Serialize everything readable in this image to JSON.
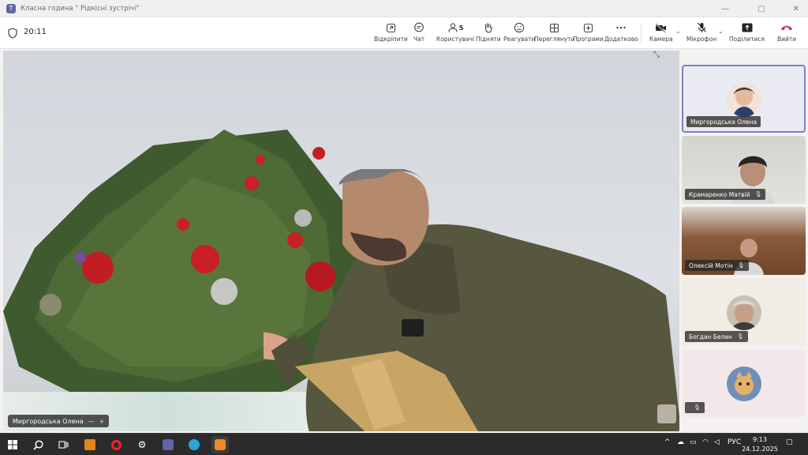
{
  "window": {
    "title": "Класна година \" Рідкісні зустрічі\"",
    "minimize": "—",
    "restore": "▢",
    "close": "✕"
  },
  "meeting": {
    "timer": "20:11"
  },
  "toolbar": {
    "buttons": [
      {
        "label": "Відкріпити",
        "icon": "unpin-icon"
      },
      {
        "label": "Чат",
        "icon": "chat-icon"
      },
      {
        "label": "Користувачі",
        "icon": "people-icon",
        "count": "5"
      },
      {
        "label": "Підняти",
        "icon": "raise-hand-icon"
      },
      {
        "label": "Реагувати",
        "icon": "react-icon"
      },
      {
        "label": "Переглянути",
        "icon": "view-icon"
      },
      {
        "label": "Програми",
        "icon": "apps-icon"
      },
      {
        "label": "Додатково",
        "icon": "more-icon"
      },
      {
        "label": "Камера",
        "icon": "camera-off-icon"
      },
      {
        "label": "Мікрофон",
        "icon": "mic-off-icon"
      },
      {
        "label": "Поділитися",
        "icon": "share-icon"
      },
      {
        "label": "Вийти",
        "icon": "leave-icon"
      }
    ]
  },
  "stage": {
    "speaker_name": "Миргородська Олена",
    "minus": "—",
    "plus": "+"
  },
  "participants": [
    {
      "name": "Миргородська Олена",
      "muted": false,
      "active": true
    },
    {
      "name": "Крамаренко Матвій",
      "muted": true
    },
    {
      "name": "Олексій Мотін",
      "muted": true
    },
    {
      "name": "Богдан Белан",
      "muted": true
    },
    {
      "name": "",
      "muted": true
    }
  ],
  "taskbar": {
    "lang": "РУС",
    "time": "9:13",
    "date": "24.12.2025"
  },
  "colors": {
    "accent": "#6264a7",
    "leave": "#c4314b",
    "taskbar": "#2b2b2b"
  }
}
